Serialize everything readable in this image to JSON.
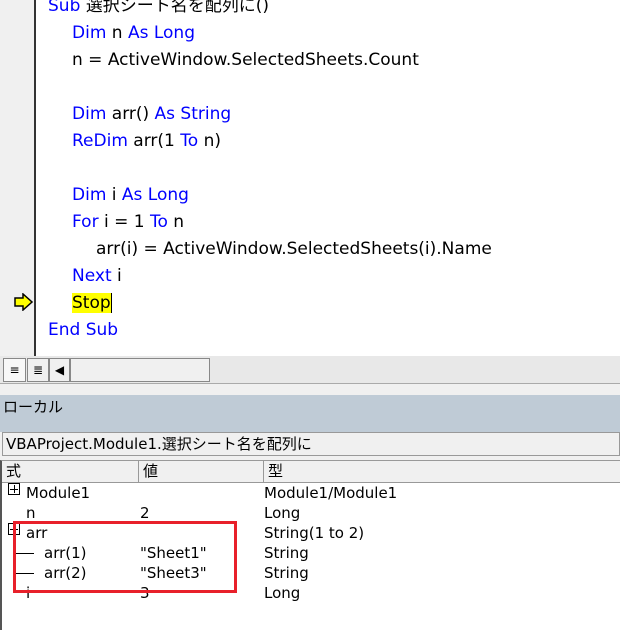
{
  "code": {
    "lines": [
      {
        "parts": [
          [
            "kw",
            "Sub "
          ],
          [
            "",
            "選択シート名を配列に()"
          ]
        ],
        "indent": 0
      },
      {
        "parts": [
          [
            "kw",
            "Dim "
          ],
          [
            "",
            "n "
          ],
          [
            "kw",
            "As Long"
          ]
        ],
        "indent": 1
      },
      {
        "parts": [
          [
            "",
            "n = ActiveWindow.SelectedSheets.Count"
          ]
        ],
        "indent": 1
      },
      {
        "parts": [],
        "indent": 1
      },
      {
        "parts": [
          [
            "kw",
            "Dim "
          ],
          [
            "",
            "arr() "
          ],
          [
            "kw",
            "As String"
          ]
        ],
        "indent": 1
      },
      {
        "parts": [
          [
            "kw",
            "ReDim "
          ],
          [
            "",
            "arr(1 "
          ],
          [
            "kw",
            "To "
          ],
          [
            "",
            "n)"
          ]
        ],
        "indent": 1
      },
      {
        "parts": [],
        "indent": 1
      },
      {
        "parts": [
          [
            "kw",
            "Dim "
          ],
          [
            "",
            "i "
          ],
          [
            "kw",
            "As Long"
          ]
        ],
        "indent": 1
      },
      {
        "parts": [
          [
            "kw",
            "For "
          ],
          [
            "",
            "i = 1 "
          ],
          [
            "kw",
            "To "
          ],
          [
            "",
            "n"
          ]
        ],
        "indent": 1
      },
      {
        "parts": [
          [
            "",
            "arr(i) = ActiveWindow.SelectedSheets(i).Name"
          ]
        ],
        "indent": 2
      },
      {
        "parts": [
          [
            "kw",
            "Next "
          ],
          [
            "",
            "i"
          ]
        ],
        "indent": 1
      },
      {
        "parts": [
          [
            "hl",
            "Stop"
          ]
        ],
        "indent": 1,
        "current": true
      },
      {
        "parts": [
          [
            "kw",
            "End Sub"
          ]
        ],
        "indent": 0
      }
    ],
    "keyword_color": "#0000ff",
    "highlight_color": "#ffff00"
  },
  "toolbar": {
    "procedure_view": "≡",
    "module_view": "≣",
    "scroll_left": "◀"
  },
  "locals": {
    "title": "ローカル",
    "context": "VBAProject.Module1.選択シート名を配列に",
    "headers": [
      "式",
      "値",
      "型"
    ],
    "rows": [
      {
        "expr": "Module1",
        "value": "",
        "type": "Module1/Module1",
        "expand": true,
        "level": 0
      },
      {
        "expr": "n",
        "value": "2",
        "type": "Long",
        "level": 0
      },
      {
        "expr": "arr",
        "value": "",
        "type": "String(1 to 2)",
        "expand": true,
        "level": 0
      },
      {
        "expr": "arr(1)",
        "value": "\"Sheet1\"",
        "type": "String",
        "level": 1
      },
      {
        "expr": "arr(2)",
        "value": "\"Sheet3\"",
        "type": "String",
        "level": 1
      },
      {
        "expr": "i",
        "value": "3",
        "type": "Long",
        "level": 0
      }
    ],
    "highlight_box_color": "#e8202a"
  }
}
